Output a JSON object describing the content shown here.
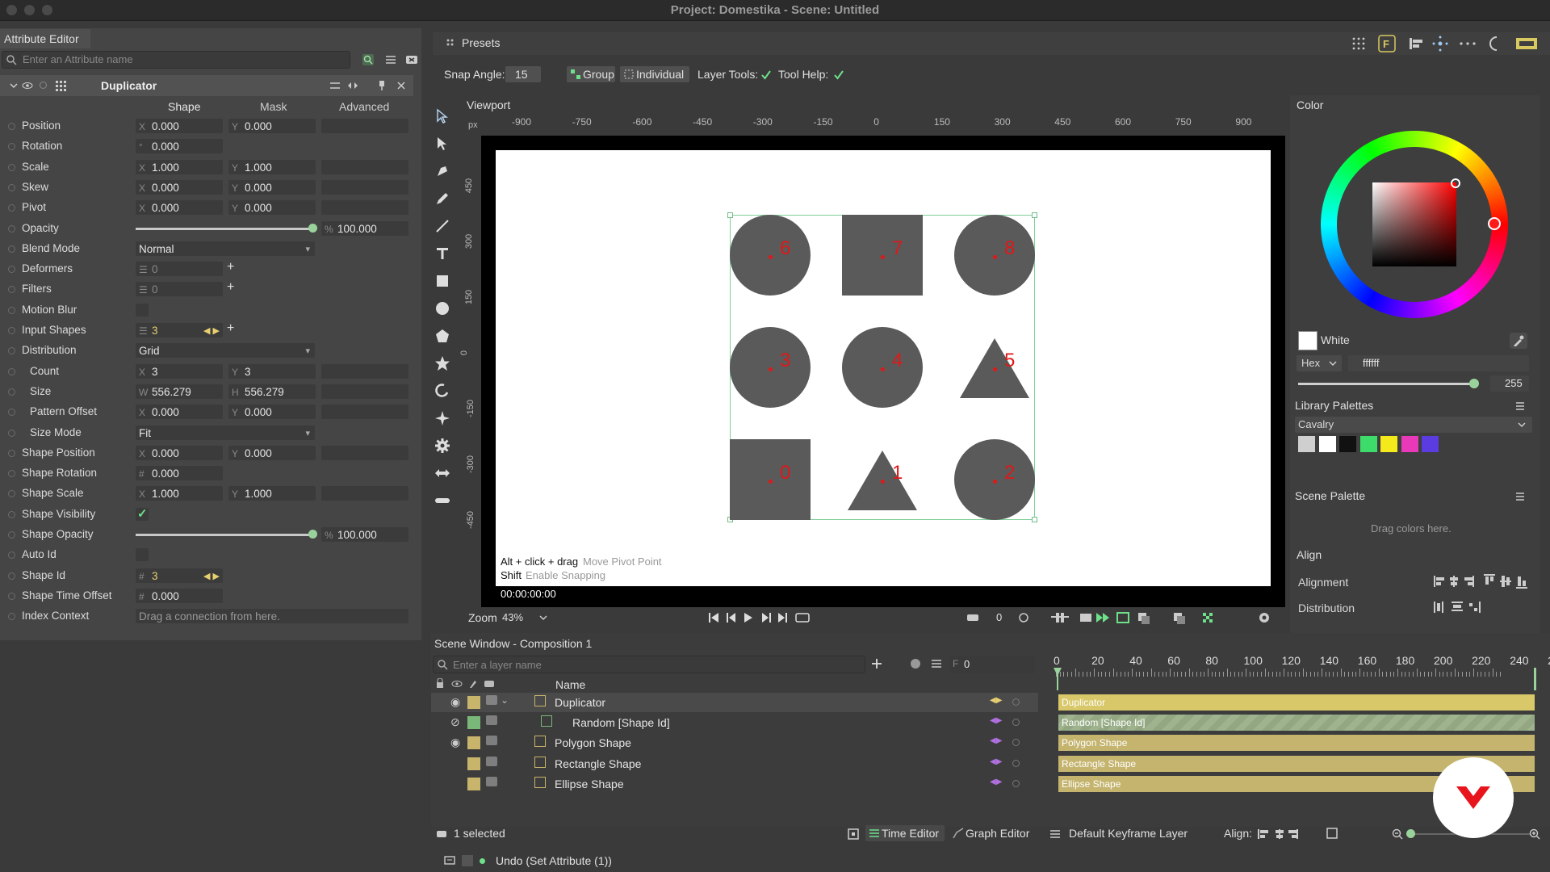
{
  "window": {
    "title": "Project: Domestika - Scene: Untitled"
  },
  "attribute_editor": {
    "tab_label": "Attribute Editor",
    "search_placeholder": "Enter an Attribute name",
    "node_name": "Duplicator",
    "sub_tabs": [
      "Shape",
      "Mask",
      "Advanced"
    ],
    "rows": [
      {
        "label": "Position",
        "type": "xy",
        "x": "0.000",
        "y": "0.000"
      },
      {
        "label": "Rotation",
        "type": "single",
        "pfx": "°",
        "value": "0.000"
      },
      {
        "label": "Scale",
        "type": "xy",
        "x": "1.000",
        "y": "1.000"
      },
      {
        "label": "Skew",
        "type": "xy",
        "x": "0.000",
        "y": "0.000"
      },
      {
        "label": "Pivot",
        "type": "xy",
        "x": "0.000",
        "y": "0.000"
      },
      {
        "label": "Opacity",
        "type": "slider",
        "pfx": "%",
        "value": "100.000"
      },
      {
        "label": "Blend Mode",
        "type": "dropdown",
        "value": "Normal"
      },
      {
        "label": "Deformers",
        "type": "list",
        "value": "0"
      },
      {
        "label": "Filters",
        "type": "list",
        "value": "0"
      },
      {
        "label": "Motion Blur",
        "type": "check",
        "checked": false
      },
      {
        "label": "Input Shapes",
        "type": "list",
        "value": "3"
      },
      {
        "label": "Distribution",
        "type": "dropdown",
        "value": "Grid"
      },
      {
        "label": "Count",
        "type": "xy",
        "x": "3",
        "y": "3",
        "indent": true
      },
      {
        "label": "Size",
        "type": "wh",
        "x": "556.279",
        "y": "556.279",
        "indent": true
      },
      {
        "label": "Pattern Offset",
        "type": "xy",
        "x": "0.000",
        "y": "0.000",
        "indent": true
      },
      {
        "label": "Size Mode",
        "type": "dropdown",
        "value": "Fit",
        "indent": true
      },
      {
        "label": "Shape Position",
        "type": "xy",
        "x": "0.000",
        "y": "0.000"
      },
      {
        "label": "Shape Rotation",
        "type": "single",
        "pfx": "#",
        "value": "0.000"
      },
      {
        "label": "Shape Scale",
        "type": "xy",
        "x": "1.000",
        "y": "1.000"
      },
      {
        "label": "Shape Visibility",
        "type": "check",
        "checked": true
      },
      {
        "label": "Shape Opacity",
        "type": "slider",
        "pfx": "%",
        "value": "100.000"
      },
      {
        "label": "Auto Id",
        "type": "check",
        "checked": false
      },
      {
        "label": "Shape Id",
        "type": "single",
        "pfx": "#",
        "value": "3",
        "linked": true
      },
      {
        "label": "Shape Time Offset",
        "type": "single",
        "pfx": "#",
        "value": "0.000"
      },
      {
        "label": "Index Context",
        "type": "connection",
        "value": "Drag a connection from here."
      }
    ]
  },
  "toolbar": {
    "presets_label": "Presets",
    "snap_angle_label": "Snap Angle:",
    "snap_angle_value": "15",
    "group_label": "Group",
    "individual_label": "Individual",
    "layer_tools_label": "Layer Tools:",
    "tool_help_label": "Tool Help:"
  },
  "viewport": {
    "label": "Viewport",
    "ruler_unit": "px",
    "ruler_h": [
      "-900",
      "-750",
      "-600",
      "-450",
      "-300",
      "-150",
      "0",
      "150",
      "300",
      "450",
      "600",
      "750",
      "900"
    ],
    "ruler_v": [
      "450",
      "300",
      "150",
      "0",
      "-150",
      "-300",
      "-450"
    ],
    "shape_ids": [
      "6",
      "7",
      "8",
      "3",
      "4",
      "5",
      "0",
      "1",
      "2"
    ],
    "hint1_key": "Alt + click + drag",
    "hint1_action": "Move Pivot Point",
    "hint2_key": "Shift",
    "hint2_action": "Enable Snapping",
    "timecode": "00:00:00:00",
    "zoom_label": "Zoom",
    "zoom_value": "43%",
    "frame_value": "0"
  },
  "color_panel": {
    "title": "Color",
    "color_name": "White",
    "mode": "Hex",
    "hex_value": "ffffff",
    "alpha_value": "255",
    "library_palettes_label": "Library Palettes",
    "palette_name": "Cavalry",
    "palette_colors": [
      "#cfcfcf",
      "#ffffff",
      "#111111",
      "#3ddc6a",
      "#f4e91b",
      "#e83ab8",
      "#5a3ce0"
    ],
    "scene_palette_label": "Scene Palette",
    "scene_palette_hint": "Drag colors here."
  },
  "align_panel": {
    "title": "Align",
    "alignment_label": "Alignment",
    "distribution_label": "Distribution"
  },
  "scene_window": {
    "title": "Scene Window - Composition 1",
    "search_placeholder": "Enter a layer name",
    "frame_field": "0",
    "name_header": "Name",
    "layers": [
      "Duplicator",
      "Random [Shape Id]",
      "Polygon Shape",
      "Rectangle Shape",
      "Ellipse Shape"
    ],
    "timeline_ticks": [
      "0",
      "20",
      "40",
      "60",
      "80",
      "100",
      "120",
      "140",
      "160",
      "180",
      "200",
      "220",
      "240",
      "2"
    ],
    "selected_count": "1 selected",
    "time_editor_label": "Time Editor",
    "graph_editor_label": "Graph Editor",
    "keyframe_layer_label": "Default Keyframe Layer",
    "align_label": "Align:",
    "undo_label": "Undo (Set Attribute (1))"
  }
}
